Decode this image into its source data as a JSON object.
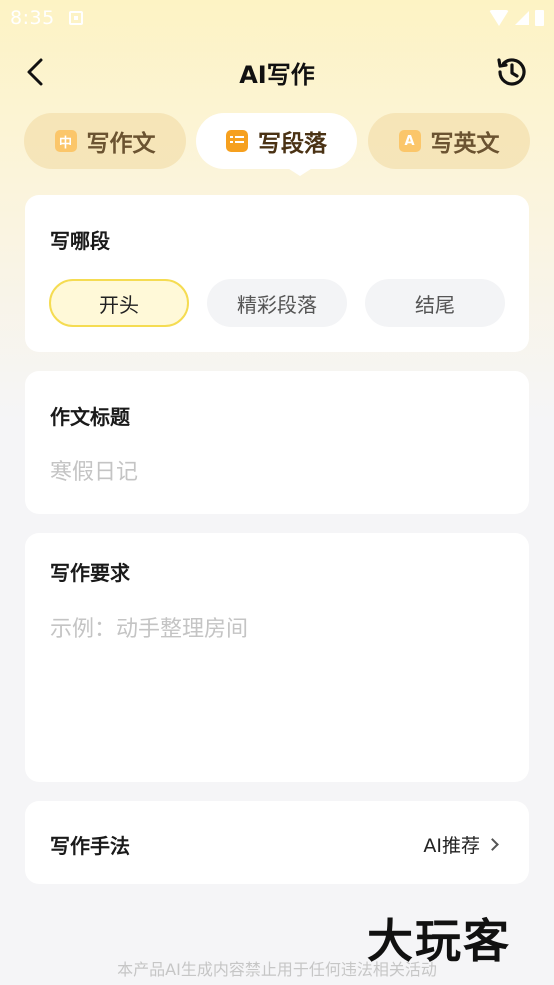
{
  "status_bar": {
    "time": "8:35",
    "text_color": "#ffffff"
  },
  "header": {
    "title": "AI写作",
    "back_icon": "chevron-left-icon",
    "history_icon": "history-icon"
  },
  "tabs": [
    {
      "label": "写作文",
      "icon": "中",
      "active": false
    },
    {
      "label": "写段落",
      "icon": "list-icon",
      "active": true
    },
    {
      "label": "写英文",
      "icon": "A",
      "active": false
    }
  ],
  "section_card": {
    "title": "写哪段",
    "options": [
      {
        "label": "开头",
        "selected": true
      },
      {
        "label": "精彩段落",
        "selected": false
      },
      {
        "label": "结尾",
        "selected": false
      }
    ]
  },
  "title_card": {
    "title": "作文标题",
    "placeholder": "寒假日记",
    "value": ""
  },
  "requirement_card": {
    "title": "写作要求",
    "placeholder": "示例：动手整理房间",
    "value": ""
  },
  "method_card": {
    "title": "写作手法",
    "value": "AI推荐"
  },
  "footer": {
    "note": "本产品AI生成内容禁止用于任何违法相关活动"
  },
  "watermark": {
    "text": "大玩客"
  },
  "colors": {
    "accent_orange": "#f6a01e",
    "selected_border": "#f5dc52",
    "selected_bg": "#fff9d8",
    "tab_inactive_bg": "#f0d8a0",
    "header_gradient_top": "#fdf3c4",
    "page_bg": "#f5f5f7"
  }
}
